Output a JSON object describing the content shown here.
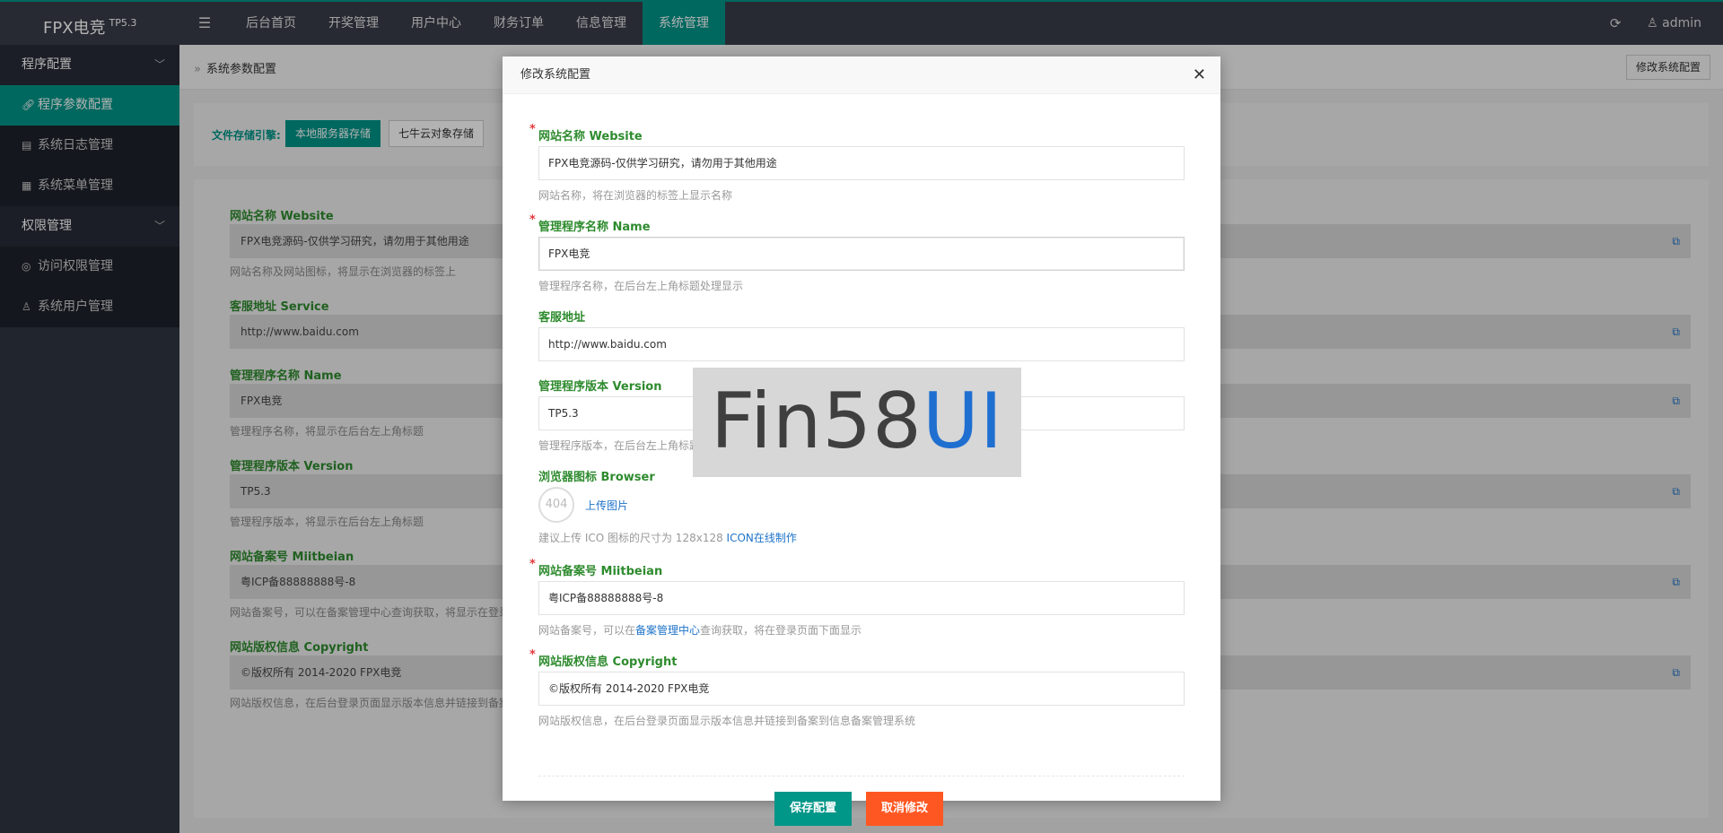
{
  "app": {
    "name": "FPX电竞",
    "version": "TP5.3"
  },
  "topnav": [
    "后台首页",
    "开奖管理",
    "用户中心",
    "财务订单",
    "信息管理",
    "系统管理"
  ],
  "topnav_active": 5,
  "user": {
    "name": "admin"
  },
  "sidebar": {
    "group1": "程序配置",
    "items1": [
      "程序参数配置",
      "系统日志管理",
      "系统菜单管理"
    ],
    "group2": "权限管理",
    "items2": [
      "访问权限管理",
      "系统用户管理"
    ]
  },
  "breadcrumb": "系统参数配置",
  "edit_button": "修改系统配置",
  "storage": {
    "label": "文件存储引擎:",
    "options": [
      "本地服务器存储",
      "七牛云对象存储"
    ]
  },
  "background_form": [
    {
      "label": "网站名称 Website",
      "value": "FPX电竞源码-仅供学习研究，请勿用于其他用途",
      "help": "网站名称及网站图标，将显示在浏览器的标签上"
    },
    {
      "label": "客服地址 Service",
      "value": "http://www.baidu.com",
      "help": ""
    },
    {
      "label": "管理程序名称 Name",
      "value": "FPX电竞",
      "help": "管理程序名称，将显示在后台左上角标题"
    },
    {
      "label": "管理程序版本 Version",
      "value": "TP5.3",
      "help": "管理程序版本，将显示在后台左上角标题"
    },
    {
      "label": "网站备案号 Miitbeian",
      "value": "粤ICP备88888888号-8",
      "help": "网站备案号，可以在备案管理中心查询获取，将显示在登录"
    },
    {
      "label": "网站版权信息 Copyright",
      "value": "©版权所有 2014-2020 FPX电竞",
      "help": "网站版权信息，在后台登录页面显示版本信息并链接到备案"
    }
  ],
  "modal": {
    "title": "修改系统配置",
    "website": {
      "label": "网站名称 Website",
      "value": "FPX电竞源码-仅供学习研究，请勿用于其他用途",
      "help": "网站名称，将在浏览器的标签上显示名称"
    },
    "name": {
      "label": "管理程序名称 Name",
      "value": "FPX电竞",
      "help": "管理程序名称，在后台左上角标题处理显示"
    },
    "service": {
      "label": "客服地址",
      "value": "http://www.baidu.com"
    },
    "version": {
      "label": "管理程序版本 Version",
      "value": "TP5.3",
      "help": "管理程序版本，在后台左上角标题处理显示"
    },
    "browser": {
      "label": "浏览器图标 Browser",
      "img_text": "404",
      "upload": "上传图片",
      "help_prefix": "建议上传 ICO 图标的尺寸为 128x128 ",
      "help_link": "ICON在线制作"
    },
    "miitbeian": {
      "label": "网站备案号 Miitbeian",
      "value": "粤ICP备88888888号-8",
      "help_prefix": "网站备案号，可以在",
      "help_link": "备案管理中心",
      "help_suffix": "查询获取，将在登录页面下面显示"
    },
    "copyright": {
      "label": "网站版权信息 Copyright",
      "value": "©版权所有 2014-2020 FPX电竞",
      "help": "网站版权信息，在后台登录页面显示版本信息并链接到备案到信息备案管理系统"
    },
    "save": "保存配置",
    "cancel": "取消修改"
  },
  "watermark": {
    "part1": "Fin58",
    "part2": "UI"
  },
  "colors": {
    "accent": "#009688",
    "danger": "#ff5722",
    "topbar": "#393d49",
    "link": "#1e73c8"
  }
}
